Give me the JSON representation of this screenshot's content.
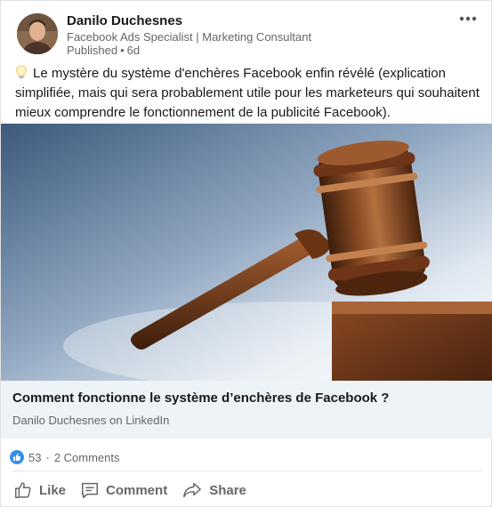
{
  "post": {
    "author": "Danilo Duchesnes",
    "headline": "Facebook Ads Specialist | Marketing Consultant",
    "status": "Published",
    "time": "6d",
    "text": "Le mystère du système d'enchères Facebook enfin révélé (explication simplifiée, mais qui sera probablement utile pour les marketeurs qui souhaitent mieux comprendre le fonctionnement de la publicité Facebook).",
    "icon": "lightbulb-icon"
  },
  "link": {
    "title": "Comment fonctionne le système d’enchères de Facebook ?",
    "source": "Danilo Duchesnes on LinkedIn"
  },
  "social": {
    "reactions": "53",
    "comments": "2 Comments"
  },
  "actions": {
    "like": "Like",
    "comment": "Comment",
    "share": "Share"
  },
  "colors": {
    "accent": "#0a66c2",
    "link_bg": "#eef3f8",
    "secondary_text": "#666666"
  }
}
